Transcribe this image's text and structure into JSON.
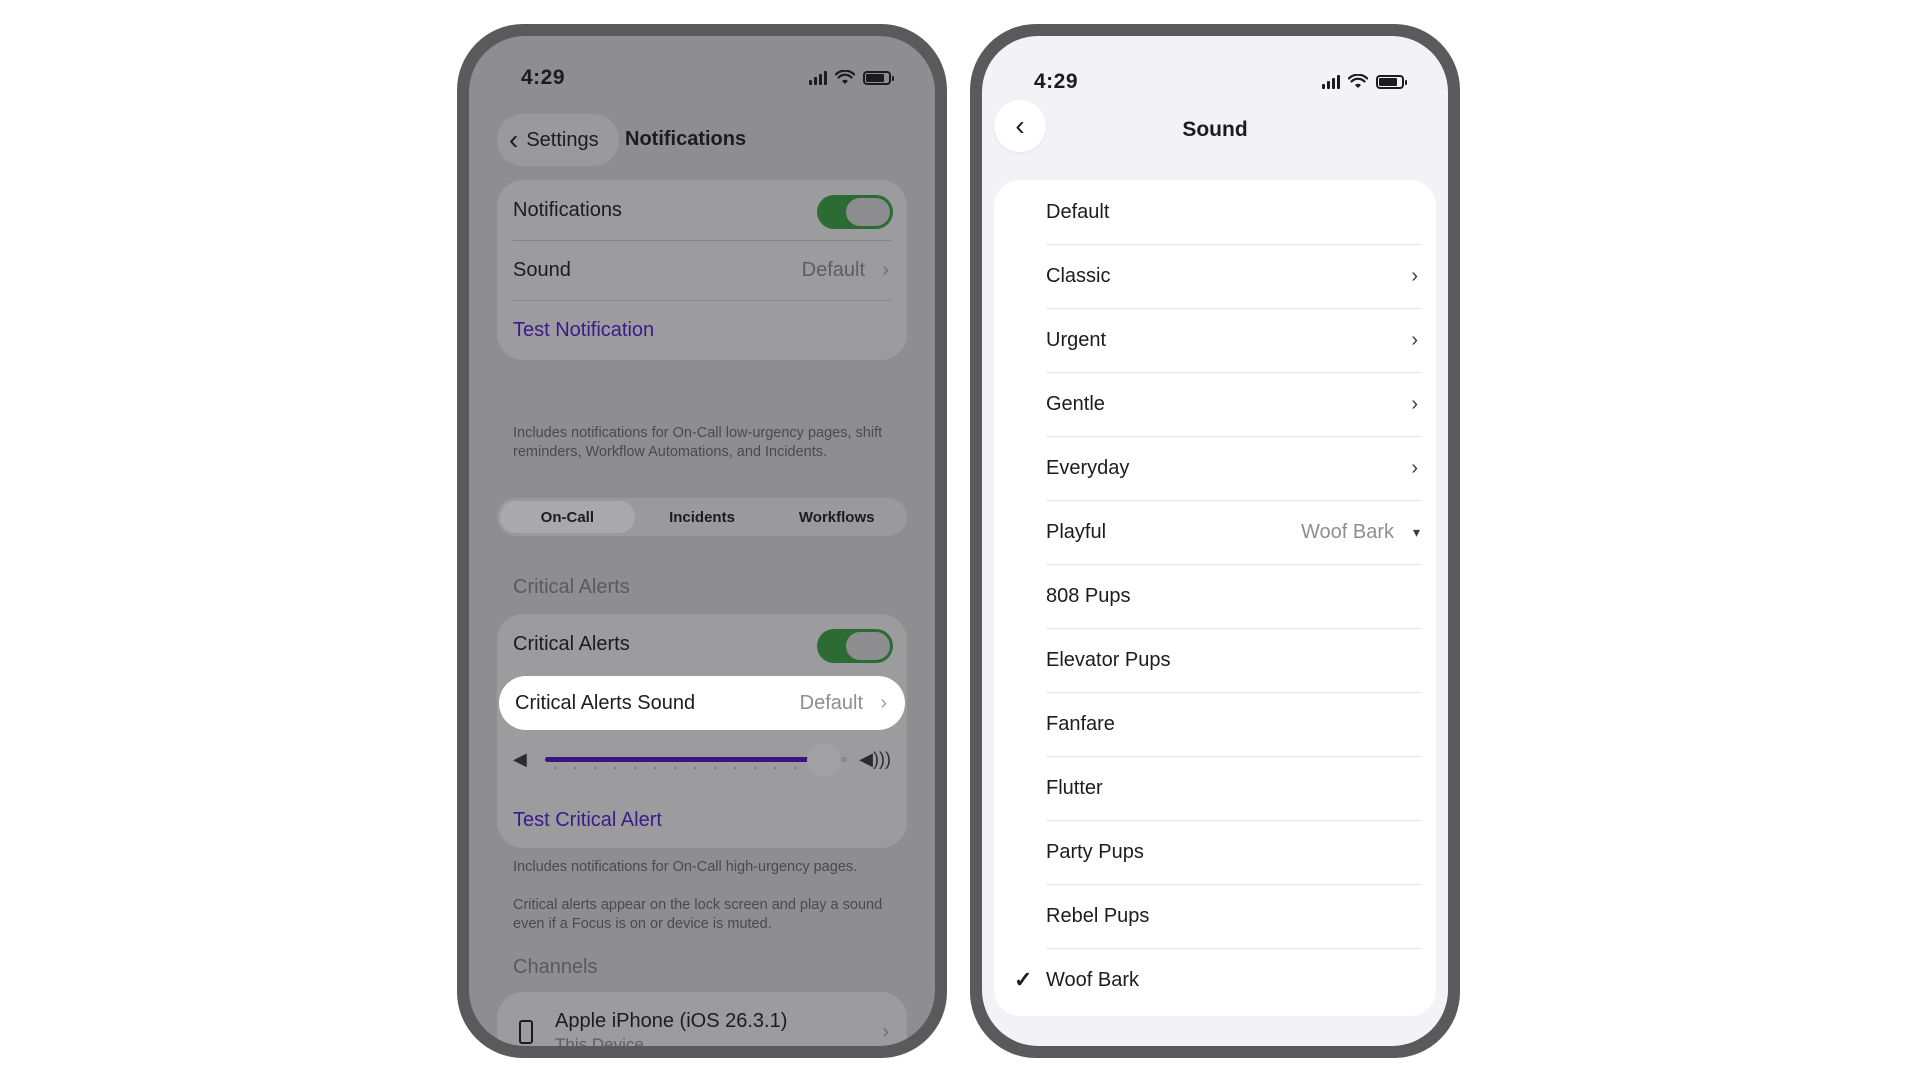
{
  "left_phone": {
    "status": {
      "time": "4:29"
    },
    "nav": {
      "back_label": "Settings",
      "title": "Notifications"
    },
    "notifications_card": {
      "notifications_label": "Notifications",
      "notifications_toggle": true,
      "sound_label": "Sound",
      "sound_value": "Default",
      "test_label": "Test Notification"
    },
    "footnote_1": "Includes notifications for On-Call low-urgency pages, shift reminders, Workflow Automations, and Incidents.",
    "segments": [
      "On-Call",
      "Incidents",
      "Workflows"
    ],
    "segments_active": "On-Call",
    "critical": {
      "header": "Critical Alerts",
      "toggle_label": "Critical Alerts",
      "toggle_on": true,
      "sound_label": "Critical Alerts Sound",
      "sound_value": "Default",
      "volume_level": 0.88,
      "test_label": "Test Critical Alert"
    },
    "footnote_2": "Includes notifications for On-Call high-urgency pages.",
    "footnote_3": "Critical alerts appear on the lock screen and play a sound even if a Focus is on or device is muted.",
    "channels": {
      "header": "Channels",
      "device_name": "Apple iPhone (iOS 26.3.1)",
      "device_sub": "This Device"
    },
    "colors": {
      "toggle_on": "#2d6b34",
      "link": "#3a1a8c",
      "slider_fill": "#3a1580"
    }
  },
  "right_phone": {
    "status": {
      "time": "4:29"
    },
    "nav": {
      "title": "Sound"
    },
    "items": [
      {
        "label": "Default"
      },
      {
        "label": "Classic",
        "chevron": true
      },
      {
        "label": "Urgent",
        "chevron": true
      },
      {
        "label": "Gentle",
        "chevron": true
      },
      {
        "label": "Everyday",
        "chevron": true
      },
      {
        "label": "Playful",
        "value": "Woof Bark",
        "expanded": true
      },
      {
        "label": "808 Pups"
      },
      {
        "label": "Elevator Pups"
      },
      {
        "label": "Fanfare"
      },
      {
        "label": "Flutter"
      },
      {
        "label": "Party Pups"
      },
      {
        "label": "Rebel Pups"
      },
      {
        "label": "Woof Bark",
        "checked": true
      }
    ]
  }
}
